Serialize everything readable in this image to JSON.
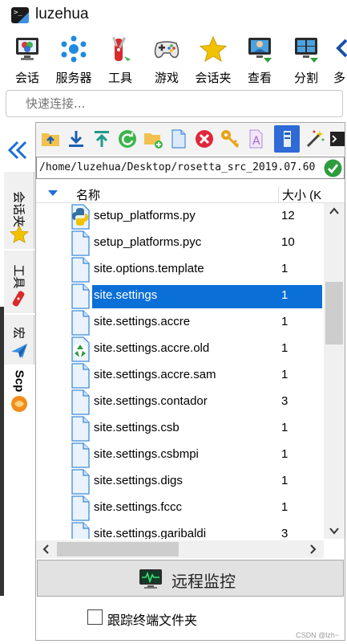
{
  "window": {
    "title": "luzehua"
  },
  "toolbar": {
    "items": [
      {
        "label": "会话",
        "icon": "monitor-icon"
      },
      {
        "label": "服务器",
        "icon": "network-icon"
      },
      {
        "label": "工具",
        "icon": "tools-icon"
      },
      {
        "label": "游戏",
        "icon": "gamepad-icon"
      },
      {
        "label": "会话夹",
        "icon": "star-icon"
      },
      {
        "label": "查看",
        "icon": "view-icon"
      },
      {
        "label": "分割",
        "icon": "split-icon"
      },
      {
        "label": "多",
        "icon": "more-icon"
      }
    ]
  },
  "quick_connect": {
    "placeholder": "快速连接..."
  },
  "side_tabs": {
    "items": [
      {
        "label": "会话夹",
        "icon": "star-icon"
      },
      {
        "label": "工具",
        "icon": "tools-icon"
      },
      {
        "label": "宏",
        "icon": "send-icon"
      },
      {
        "label": "Scp",
        "icon": "sftp-icon"
      }
    ],
    "active": "Scp"
  },
  "sftp": {
    "path": "/home/luzehua/Desktop/rosetta_src_2019.07.60",
    "columns": {
      "name": "名称",
      "size": "大小 (K"
    },
    "files": [
      {
        "name": "setup_platforms.py",
        "size": "12",
        "icon": "python-file-icon"
      },
      {
        "name": "setup_platforms.pyc",
        "size": "10",
        "icon": "file-icon"
      },
      {
        "name": "site.options.template",
        "size": "1",
        "icon": "file-icon"
      },
      {
        "name": "site.settings",
        "size": "1",
        "icon": "file-icon",
        "selected": true
      },
      {
        "name": "site.settings.accre",
        "size": "1",
        "icon": "file-icon"
      },
      {
        "name": "site.settings.accre.old",
        "size": "1",
        "icon": "recycle-file-icon"
      },
      {
        "name": "site.settings.accre.sam",
        "size": "1",
        "icon": "file-icon"
      },
      {
        "name": "site.settings.contador",
        "size": "3",
        "icon": "file-icon"
      },
      {
        "name": "site.settings.csb",
        "size": "1",
        "icon": "file-icon"
      },
      {
        "name": "site.settings.csbmpi",
        "size": "1",
        "icon": "file-icon"
      },
      {
        "name": "site.settings.digs",
        "size": "1",
        "icon": "file-icon"
      },
      {
        "name": "site.settings.fccc",
        "size": "1",
        "icon": "file-icon"
      },
      {
        "name": "site.settings.garibaldi",
        "size": "3",
        "icon": "file-icon"
      }
    ],
    "remote_monitor_label": "远程监控",
    "follow_terminal_label": "跟踪终端文件夹",
    "follow_terminal_checked": false
  },
  "watermark": "CSDN @lzh~",
  "colors": {
    "selection": "#0a6fd6",
    "accent": "#1b6fd6"
  }
}
